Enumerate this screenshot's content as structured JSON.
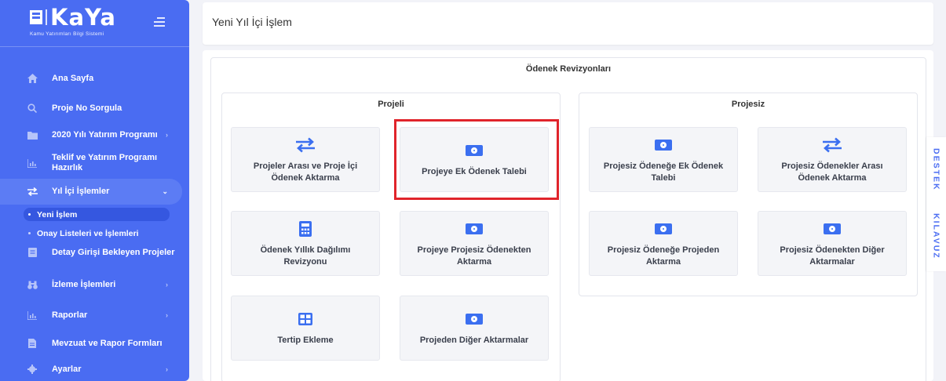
{
  "brand": {
    "name": "KaYa",
    "subtitle": "Kamu Yatırımları Bilgi Sistemi"
  },
  "sidebar": {
    "items": [
      {
        "label": "Ana Sayfa",
        "icon": "home-icon"
      },
      {
        "label": "Proje No Sorgula",
        "icon": "search-icon"
      },
      {
        "label": "2020 Yılı Yatırım Programı",
        "icon": "folder-icon"
      },
      {
        "label": "Teklif ve Yatırım Programı Hazırlık",
        "icon": "chart-icon"
      },
      {
        "label": "Yıl İçi İşlemler",
        "icon": "transfer-icon"
      },
      {
        "label": "Detay Girişi Bekleyen Projeler",
        "icon": "list-icon"
      },
      {
        "label": "İzleme İşlemleri",
        "icon": "binoculars-icon"
      },
      {
        "label": "Raporlar",
        "icon": "chart-icon"
      },
      {
        "label": "Mevzuat ve Rapor Formları",
        "icon": "document-icon"
      },
      {
        "label": "Ayarlar",
        "icon": "gear-icon"
      }
    ],
    "subitems": [
      {
        "label": "Yeni İşlem"
      },
      {
        "label": "Onay Listeleri ve İşlemleri"
      }
    ]
  },
  "header": {
    "title": "Yeni Yıl İçi İşlem"
  },
  "panel": {
    "title": "Ödenek Revizyonları",
    "projeli": {
      "title": "Projeli",
      "tiles": [
        {
          "label": "Projeler Arası ve Proje İçi Ödenek Aktarma",
          "icon": "transfer-icon"
        },
        {
          "label": "Projeye Ek Ödenek Talebi",
          "icon": "money-icon"
        },
        {
          "label": "Ödenek Yıllık Dağılımı Revizyonu",
          "icon": "calculator-icon"
        },
        {
          "label": "Projeye Projesiz Ödenekten Aktarma",
          "icon": "money-icon"
        },
        {
          "label": "Tertip Ekleme",
          "icon": "table-icon"
        },
        {
          "label": "Projeden Diğer Aktarmalar",
          "icon": "money-icon"
        }
      ]
    },
    "projesiz": {
      "title": "Projesiz",
      "tiles": [
        {
          "label": "Projesiz Ödeneğe Ek Ödenek Talebi",
          "icon": "money-icon"
        },
        {
          "label": "Projesiz Ödenekler Arası Ödenek Aktarma",
          "icon": "transfer-icon"
        },
        {
          "label": "Projesiz Ödeneğe Projeden Aktarma",
          "icon": "money-icon"
        },
        {
          "label": "Projesiz Ödenekten Diğer Aktarmalar",
          "icon": "money-icon"
        }
      ]
    }
  },
  "side_tabs": {
    "destek": "DESTEK",
    "kilavuz": "KILAVUZ"
  },
  "colors": {
    "sidebar": "#4a6cf2",
    "accent": "#3b6ff0",
    "highlight": "#e0242b"
  }
}
